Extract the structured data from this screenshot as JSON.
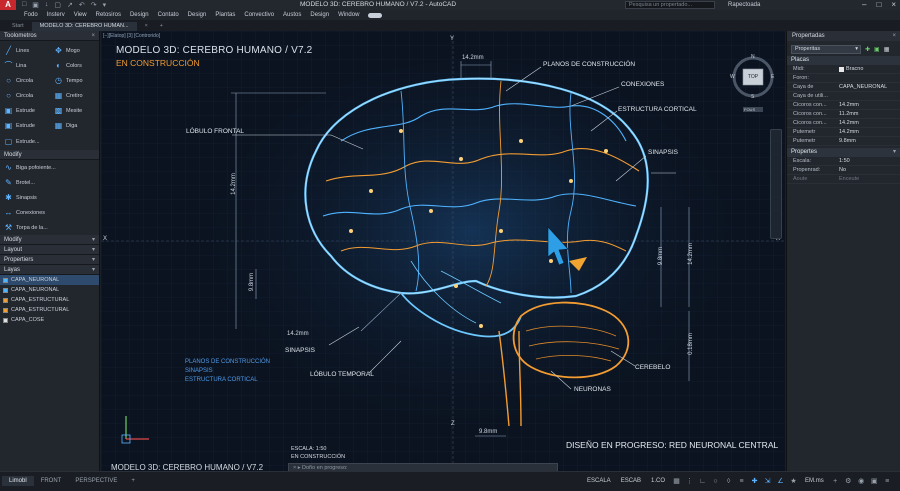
{
  "titlebar": {
    "app_letter": "A",
    "window_title": "MODELO 3D: CEREBRO HUMANO / V7.2 - AutoCAD",
    "search_placeholder": "Pesquisa un propertado...",
    "user": "Rapectoada",
    "quick_access": [
      "□",
      "▣",
      "↓",
      "▢",
      "↗",
      "↶",
      "↷",
      "▾"
    ]
  },
  "menu": [
    "Fodo",
    "Insterv",
    "View",
    "Retosiros",
    "Design",
    "Contato",
    "Design",
    "Plantas",
    "Convectivo",
    "Austos",
    "Design",
    "Window"
  ],
  "tabs": [
    "Start",
    "MODELO 3D: CEREBRO HUMAN..."
  ],
  "left_panel": {
    "toolometros_title": "Toolometros",
    "tools_grid": [
      {
        "label": "Lines",
        "icon": "line-icon"
      },
      {
        "label": "Mogo",
        "icon": "move-icon"
      },
      {
        "label": "Lina",
        "icon": "polyline-icon"
      },
      {
        "label": "Colors",
        "icon": "colors-icon"
      },
      {
        "label": "Circola",
        "icon": "circle-icon"
      },
      {
        "label": "Tempo",
        "icon": "tempo-icon"
      },
      {
        "label": "Circola",
        "icon": "circle-icon"
      },
      {
        "label": "Cretiro",
        "icon": "grid-icon"
      },
      {
        "label": "Estrude",
        "icon": "extrude-icon"
      },
      {
        "label": "Mesite",
        "icon": "mesh-icon"
      },
      {
        "label": "Estrude",
        "icon": "extrude-icon"
      },
      {
        "label": "Diga",
        "icon": "grid-icon"
      }
    ],
    "extrude_more": "Extrude...",
    "modify_title": "Modify",
    "modify_tools": [
      {
        "label": "Biga pofoiente...",
        "icon": "curve-icon"
      },
      {
        "label": "Brotel...",
        "icon": "brush-icon"
      },
      {
        "label": "Sinapsis",
        "icon": "synapse-icon"
      },
      {
        "label": "Conexiones",
        "icon": "connection-icon"
      },
      {
        "label": "Torpa de la...",
        "icon": "tool-icon"
      }
    ],
    "sections": [
      "Modify",
      "Layout",
      "Propertiers"
    ],
    "layers_title": "Layas",
    "layers": [
      {
        "name": "CAPA_NEURONAL",
        "color": "#4fb3ff"
      },
      {
        "name": "CAPA_NEURONAL",
        "color": "#4fb3ff"
      },
      {
        "name": "CAPA_ESTRUCTURAL",
        "color": "#f0a030"
      },
      {
        "name": "CAPA_ESTRUCTURAL",
        "color": "#f0a030"
      },
      {
        "name": "CAPA_COSE",
        "color": "#e0e0e0"
      }
    ]
  },
  "canvas": {
    "viewport_label": "[−][Elatop] [3] [Controrido]",
    "model_title": "MODELO 3D: CEREBRO HUMANO / V7.2",
    "status": "EN CONSTRUCCIÓN",
    "annotations": {
      "planos": "PLANOS DE CONSTRUCCIÓN",
      "conexiones": "CONEXIONES",
      "estructura": "ESTRUCTURA CORTICAL",
      "lobulo_frontal": "LÓBULO FRONTAL",
      "sinapsis_right": "SINAPSIS",
      "sinapsis_left": "SINAPSIS",
      "lobulo_temporal": "LÓBULO TEMPORAL",
      "neuronas": "NEURONAS",
      "cerebelo": "CEREBELO"
    },
    "dims": {
      "top": "14.2mm",
      "left_v": "14.2mm",
      "left_small": "9.8mm",
      "bottom_left": "14.2mm",
      "right_a": "9.8mm",
      "right_b": "14.2mm",
      "right_c": "0.18mm",
      "bottom": "9.8mm"
    },
    "axis": {
      "x": "X",
      "y": "Y",
      "z": "Z"
    },
    "legend": [
      "PLANOS DE CONSTRUCCIÓN",
      "SINAPSIS",
      "ESTRUCTURA CORTICAL"
    ],
    "footer_right": "DISEÑO EN PROGRESO: RED NEURONAL CENTRAL",
    "footer_left": "MODELO 3D: CEREBRO HUMANO / V7.2",
    "scale": "ESCALA: 1:50",
    "scale_status": "EN CONSTRUCCIÓN",
    "command_placeholder": "Doño en progreso:",
    "viewcube": {
      "top": "TOP",
      "n": "N",
      "s": "S",
      "e": "E",
      "w": "W",
      "mode": "FOUS"
    }
  },
  "right_panel": {
    "title": "Propertadas",
    "select_value": "Properitas",
    "placas_title": "Placas",
    "placas_rows": [
      {
        "k": "Midi:",
        "v": "Bracno",
        "chk": true
      },
      {
        "k": "Foron:",
        "v": ""
      },
      {
        "k": "Caya de",
        "v": "CAPA_NEURONAL"
      },
      {
        "k": "Caya de utili...",
        "v": ""
      },
      {
        "k": "Cicoros con...",
        "v": "14.2mm"
      },
      {
        "k": "Cicoros con...",
        "v": "11.2mm"
      },
      {
        "k": "Cicoros con...",
        "v": "14.2mm"
      },
      {
        "k": "Putemetr",
        "v": "14.2mm"
      },
      {
        "k": "Putemetr",
        "v": "9.8mm"
      }
    ],
    "propertes_title": "Propertes",
    "propertes_rows": [
      {
        "k": "Escala:",
        "v": "1:50"
      },
      {
        "k": "Propenrad:",
        "v": "No"
      },
      {
        "k": "Aoute",
        "v": "Enceute",
        "dim": true
      }
    ]
  },
  "statusbar": {
    "tabs": [
      "Limobl",
      "FRONT",
      "PERSPECTIVE",
      "+"
    ],
    "right": [
      "ESCALA",
      "ESCAB",
      "1.CO"
    ],
    "units": "EM.ms"
  },
  "colors": {
    "accent_orange": "#f29c32",
    "accent_blue": "#4fb3ff",
    "canvas_bg": "#0b1320",
    "autocad_red": "#c8282d"
  }
}
